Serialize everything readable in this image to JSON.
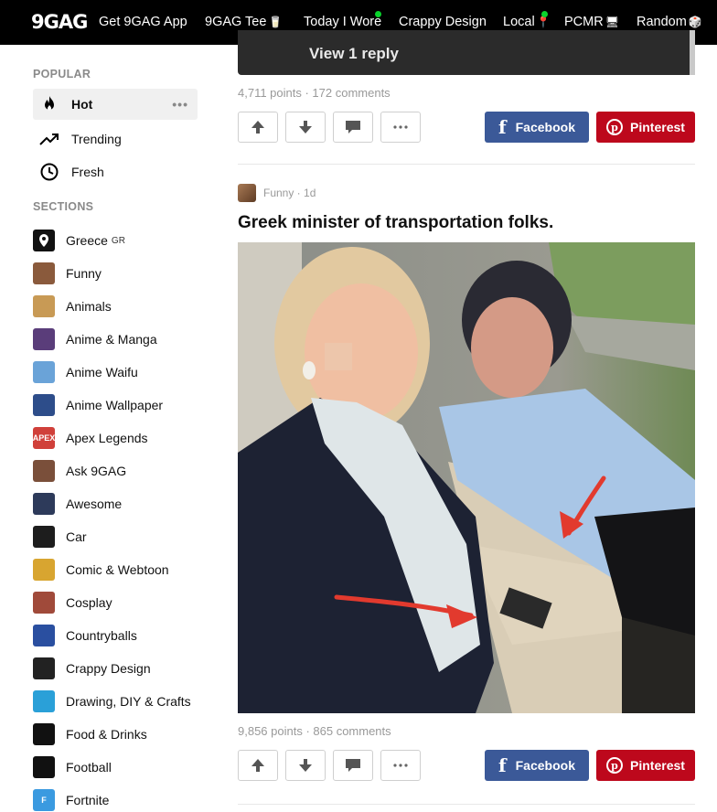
{
  "topbar": {
    "logo": "9GAG",
    "nav": [
      {
        "label": "Get 9GAG App"
      },
      {
        "label": "9GAG Tee",
        "suffix": "🥛"
      },
      {
        "label": "Today I Wore"
      },
      {
        "label": "Crappy Design"
      },
      {
        "label": "Local",
        "suffix": "📍"
      },
      {
        "label": "PCMR",
        "suffix": "🖥"
      },
      {
        "label": "Random",
        "suffix": "🎲"
      }
    ]
  },
  "sidebar": {
    "popular_header": "POPULAR",
    "popular": [
      {
        "label": "Hot",
        "icon": "flame-icon"
      },
      {
        "label": "Trending",
        "icon": "trending-icon"
      },
      {
        "label": "Fresh",
        "icon": "clock-icon"
      }
    ],
    "more_label": "•••",
    "sections_header": "SECTIONS",
    "sections": [
      {
        "label": "Greece",
        "sub": "GR",
        "color": "#111111",
        "icon": "map-pin-icon"
      },
      {
        "label": "Funny",
        "color": "#8a5a3c",
        "icon": "funny-thumb"
      },
      {
        "label": "Animals",
        "color": "#c89a55",
        "icon": "animals-thumb"
      },
      {
        "label": "Anime & Manga",
        "color": "#5a3d7a",
        "icon": "anime-thumb"
      },
      {
        "label": "Anime Waifu",
        "color": "#6aa3d8",
        "icon": "waifu-thumb"
      },
      {
        "label": "Anime Wallpaper",
        "color": "#2d4d8a",
        "icon": "wallpaper-thumb"
      },
      {
        "label": "Apex Legends",
        "color": "#d0403a",
        "icon": "apex-thumb",
        "text": "APEX"
      },
      {
        "label": "Ask 9GAG",
        "color": "#7a4f3a",
        "icon": "ask-thumb"
      },
      {
        "label": "Awesome",
        "color": "#2d3a5a",
        "icon": "awesome-thumb"
      },
      {
        "label": "Car",
        "color": "#1d1d1d",
        "icon": "car-thumb"
      },
      {
        "label": "Comic & Webtoon",
        "color": "#d8a530",
        "icon": "comic-thumb"
      },
      {
        "label": "Cosplay",
        "color": "#a04a3a",
        "icon": "cosplay-thumb"
      },
      {
        "label": "Countryballs",
        "color": "#2a4fa0",
        "icon": "countryballs-thumb"
      },
      {
        "label": "Crappy Design",
        "color": "#222222",
        "icon": "crappy-thumb"
      },
      {
        "label": "Drawing, DIY & Crafts",
        "color": "#2aa0d8",
        "icon": "diamond-thumb"
      },
      {
        "label": "Food & Drinks",
        "color": "#111111",
        "icon": "pizza-thumb"
      },
      {
        "label": "Football",
        "color": "#111111",
        "icon": "football-thumb"
      },
      {
        "label": "Fortnite",
        "color": "#3a9ae0",
        "icon": "fortnite-thumb",
        "text": "F"
      }
    ]
  },
  "prev_post": {
    "reply_button": "View 1 reply",
    "stats": "4,711 points · 172 comments"
  },
  "post": {
    "section": "Funny · 1d",
    "title": "Greek minister of transportation folks.",
    "stats": "9,856 points · 865 comments"
  },
  "share": {
    "facebook": "Facebook",
    "pinterest": "Pinterest"
  },
  "colors": {
    "facebook": "#3b5998",
    "pinterest": "#bd081c",
    "topbar": "#000000",
    "nav_dot": "#09d32c"
  }
}
